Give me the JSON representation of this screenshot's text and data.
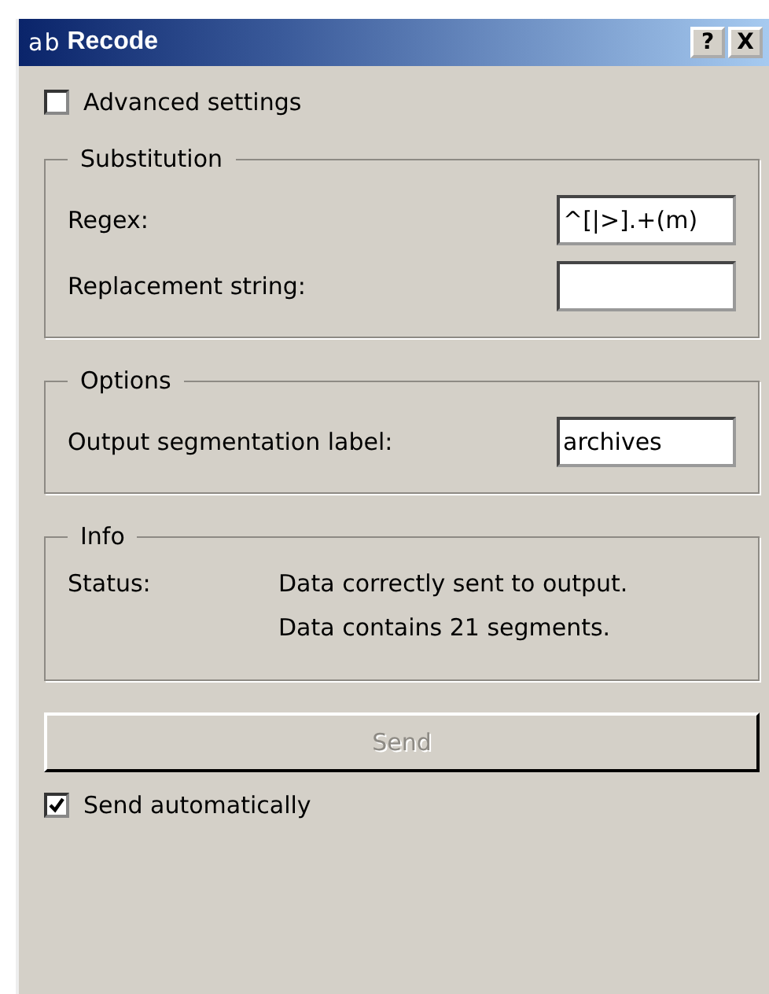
{
  "window": {
    "icon_text": "ab",
    "title": "Recode",
    "buttons": [
      "?",
      "X"
    ]
  },
  "advanced": {
    "label": "Advanced settings",
    "checked": false
  },
  "groups": [
    {
      "title": "Substitution",
      "fields": [
        {
          "label": "Regex:",
          "value": "^[|>].+(m)"
        },
        {
          "label": "Replacement string:"
        }
      ]
    },
    {
      "title": "Options",
      "fields": [
        {
          "label": "Output segmentation label:",
          "value": "archives"
        }
      ]
    }
  ],
  "info": {
    "title": "Info",
    "label": "Status:",
    "lines": [
      "Data correctly sent to output.",
      "Data contains 21 segments."
    ]
  },
  "send_button": {
    "label": "Send",
    "disabled": true
  },
  "auto_send": {
    "label": "Send automatically",
    "checked": true
  }
}
